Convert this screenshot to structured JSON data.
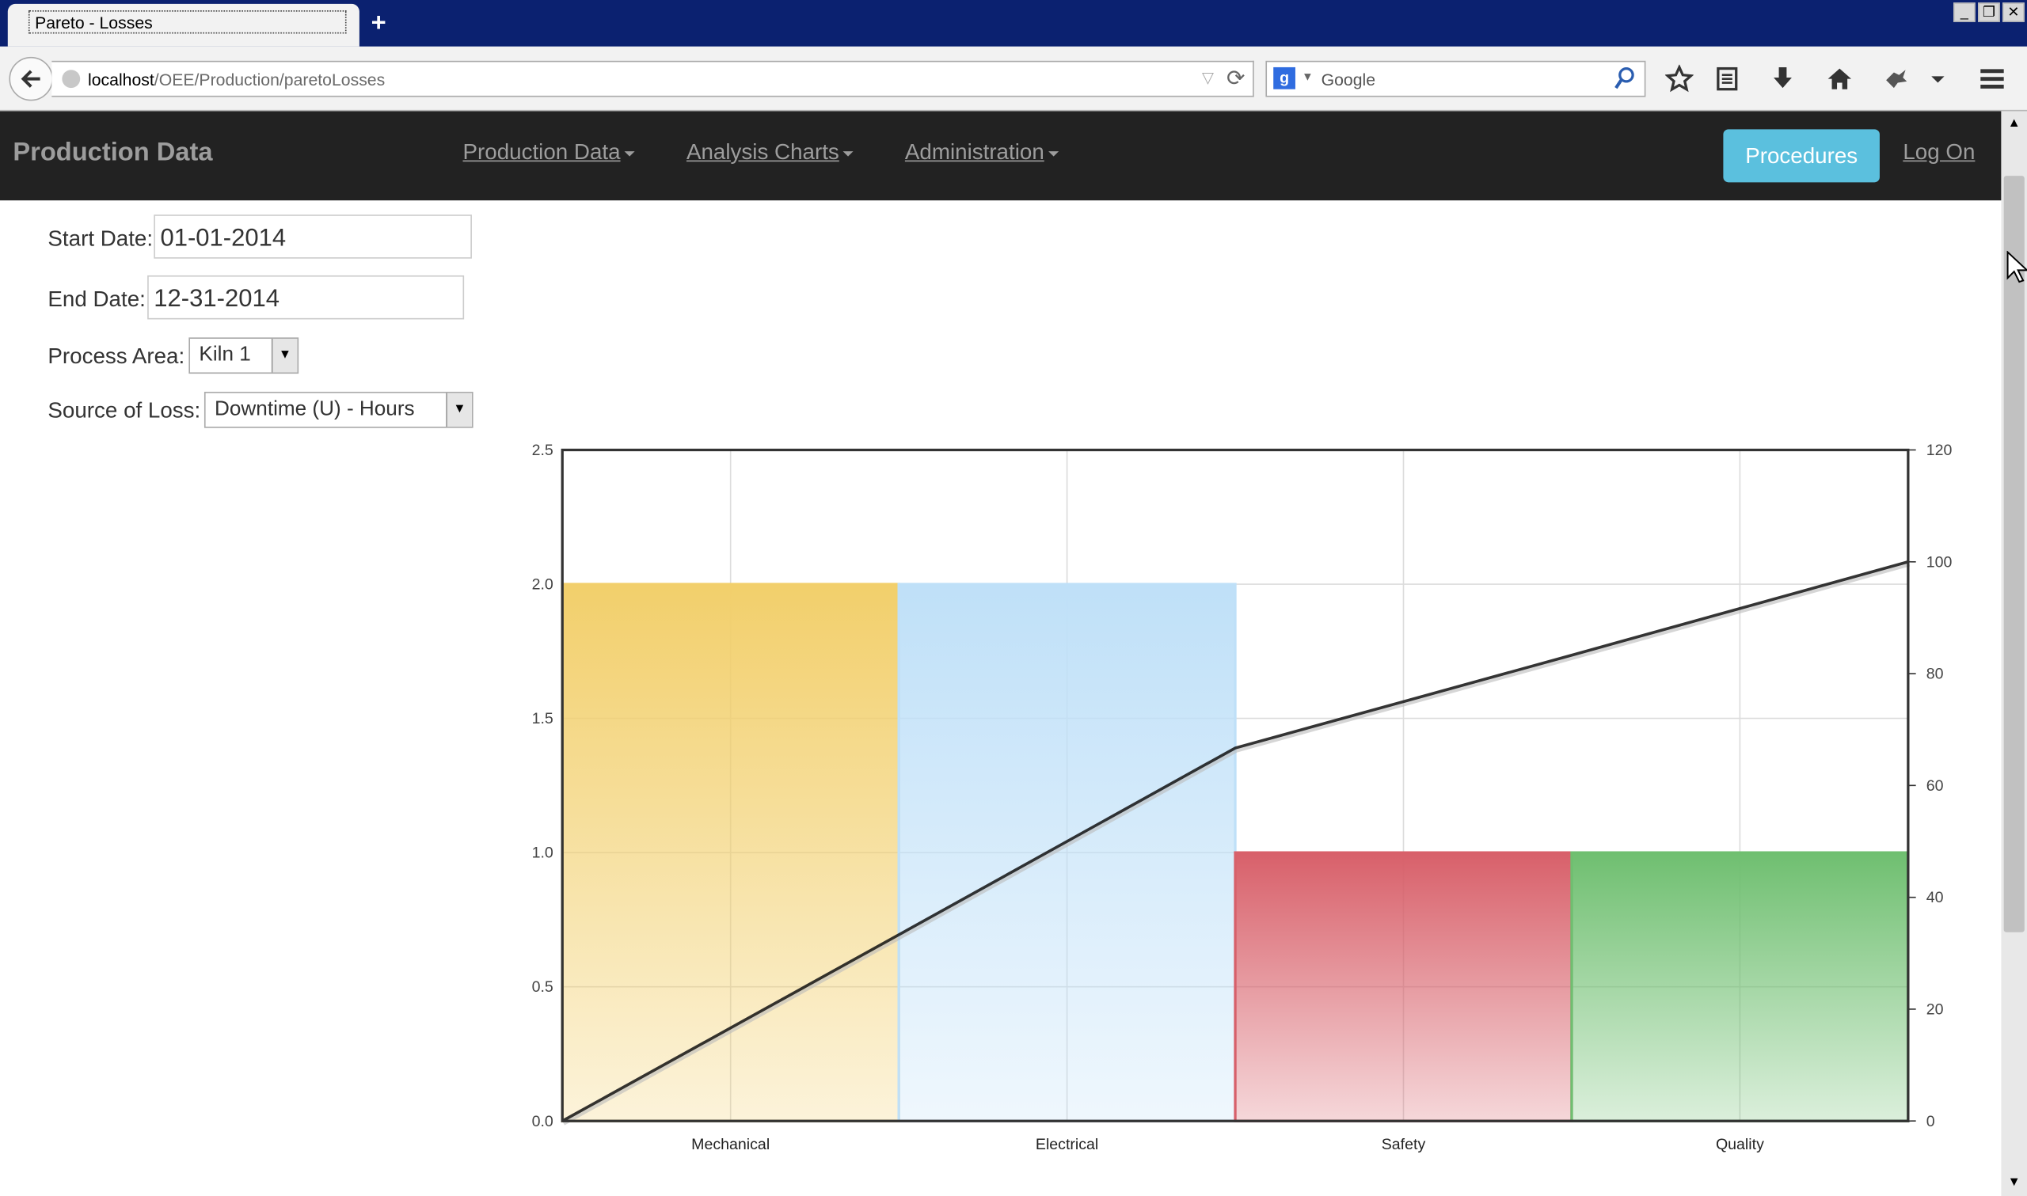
{
  "browser": {
    "tab_title": "Pareto - Losses",
    "new_tab_label": "+",
    "url_host": "localhost",
    "url_path": "/OEE/Production/paretoLosses",
    "search_placeholder": "Google",
    "search_engine_letter": "g",
    "window_buttons": {
      "minimize": "_",
      "restore": "❐",
      "close": "✕"
    },
    "icons": [
      "back-arrow-icon",
      "globe-icon",
      "reload-icon",
      "google-icon",
      "magnifier-icon",
      "star-icon",
      "reading-list-icon",
      "download-icon",
      "home-icon",
      "addon-icon",
      "menu-icon"
    ]
  },
  "nav": {
    "brand": "Production Data",
    "menus": [
      "Production Data",
      "Analysis Charts",
      "Administration"
    ],
    "procedures_button": "Procedures",
    "log_on": "Log On"
  },
  "form": {
    "start_date_label": "Start Date:",
    "start_date_value": "01-01-2014",
    "end_date_label": "End Date:",
    "end_date_value": "12-31-2014",
    "process_area_label": "Process Area:",
    "process_area_value": "Kiln 1",
    "source_label": "Source of Loss:",
    "source_value": "Downtime (U) - Hours"
  },
  "chart_data": {
    "type": "bar",
    "categories": [
      "Mechanical",
      "Electrical",
      "Safety",
      "Quality"
    ],
    "values": [
      2.0,
      2.0,
      1.0,
      1.0
    ],
    "bar_colors": [
      "#f2cf6b",
      "#bfe0f8",
      "#d8606a",
      "#6fbf70"
    ],
    "cumulative_percent": [
      0,
      33.3,
      66.7,
      83.3,
      100
    ],
    "y_left": {
      "min": 0,
      "max": 2.5,
      "ticks": [
        "0.0",
        "0.5",
        "1.0",
        "1.5",
        "2.0",
        "2.5"
      ]
    },
    "y_right": {
      "min": 0,
      "max": 120,
      "ticks": [
        "0",
        "20",
        "40",
        "60",
        "80",
        "100",
        "120"
      ]
    },
    "grid": true,
    "line_color": "#111111"
  }
}
